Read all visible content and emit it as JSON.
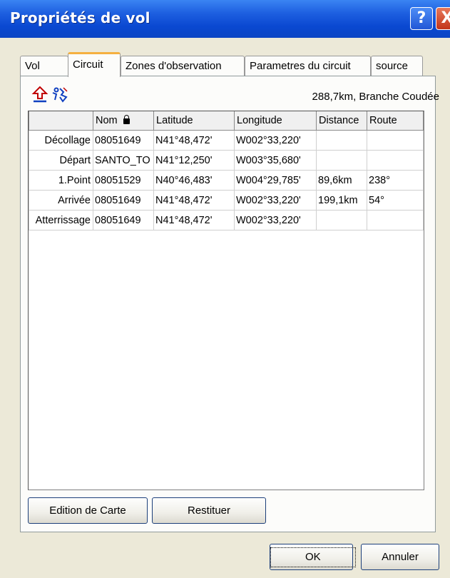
{
  "window": {
    "title": "Propriétés de vol",
    "help_label": "?",
    "close_label": "X"
  },
  "tabs": [
    {
      "label": "Vol"
    },
    {
      "label": "Circuit"
    },
    {
      "label": "Zones d'observation"
    },
    {
      "label": "Parametres du circuit"
    },
    {
      "label": "source"
    }
  ],
  "toolbar": {
    "summary": "288,7km, Branche Coudée"
  },
  "grid": {
    "columns": [
      "",
      "Nom",
      "Latitude",
      "Longitude",
      "Distance",
      "Route"
    ],
    "rows": [
      {
        "label": "Décollage",
        "nom": "08051649",
        "lat": "N41°48,472'",
        "lon": "W002°33,220'",
        "dist": "",
        "route": ""
      },
      {
        "label": "Départ",
        "nom": "SANTO_TO",
        "lat": "N41°12,250'",
        "lon": "W003°35,680'",
        "dist": "",
        "route": ""
      },
      {
        "label": "1.Point",
        "nom": "08051529",
        "lat": "N40°46,483'",
        "lon": "W004°29,785'",
        "dist": "89,6km",
        "route": "238°"
      },
      {
        "label": "Arrivée",
        "nom": "08051649",
        "lat": "N41°48,472'",
        "lon": "W002°33,220'",
        "dist": "199,1km",
        "route": "54°"
      },
      {
        "label": "Atterrissage",
        "nom": "08051649",
        "lat": "N41°48,472'",
        "lon": "W002°33,220'",
        "dist": "",
        "route": ""
      }
    ]
  },
  "buttons": {
    "edit_map": "Edition de Carte",
    "restore": "Restituer",
    "ok": "OK",
    "cancel": "Annuler"
  }
}
